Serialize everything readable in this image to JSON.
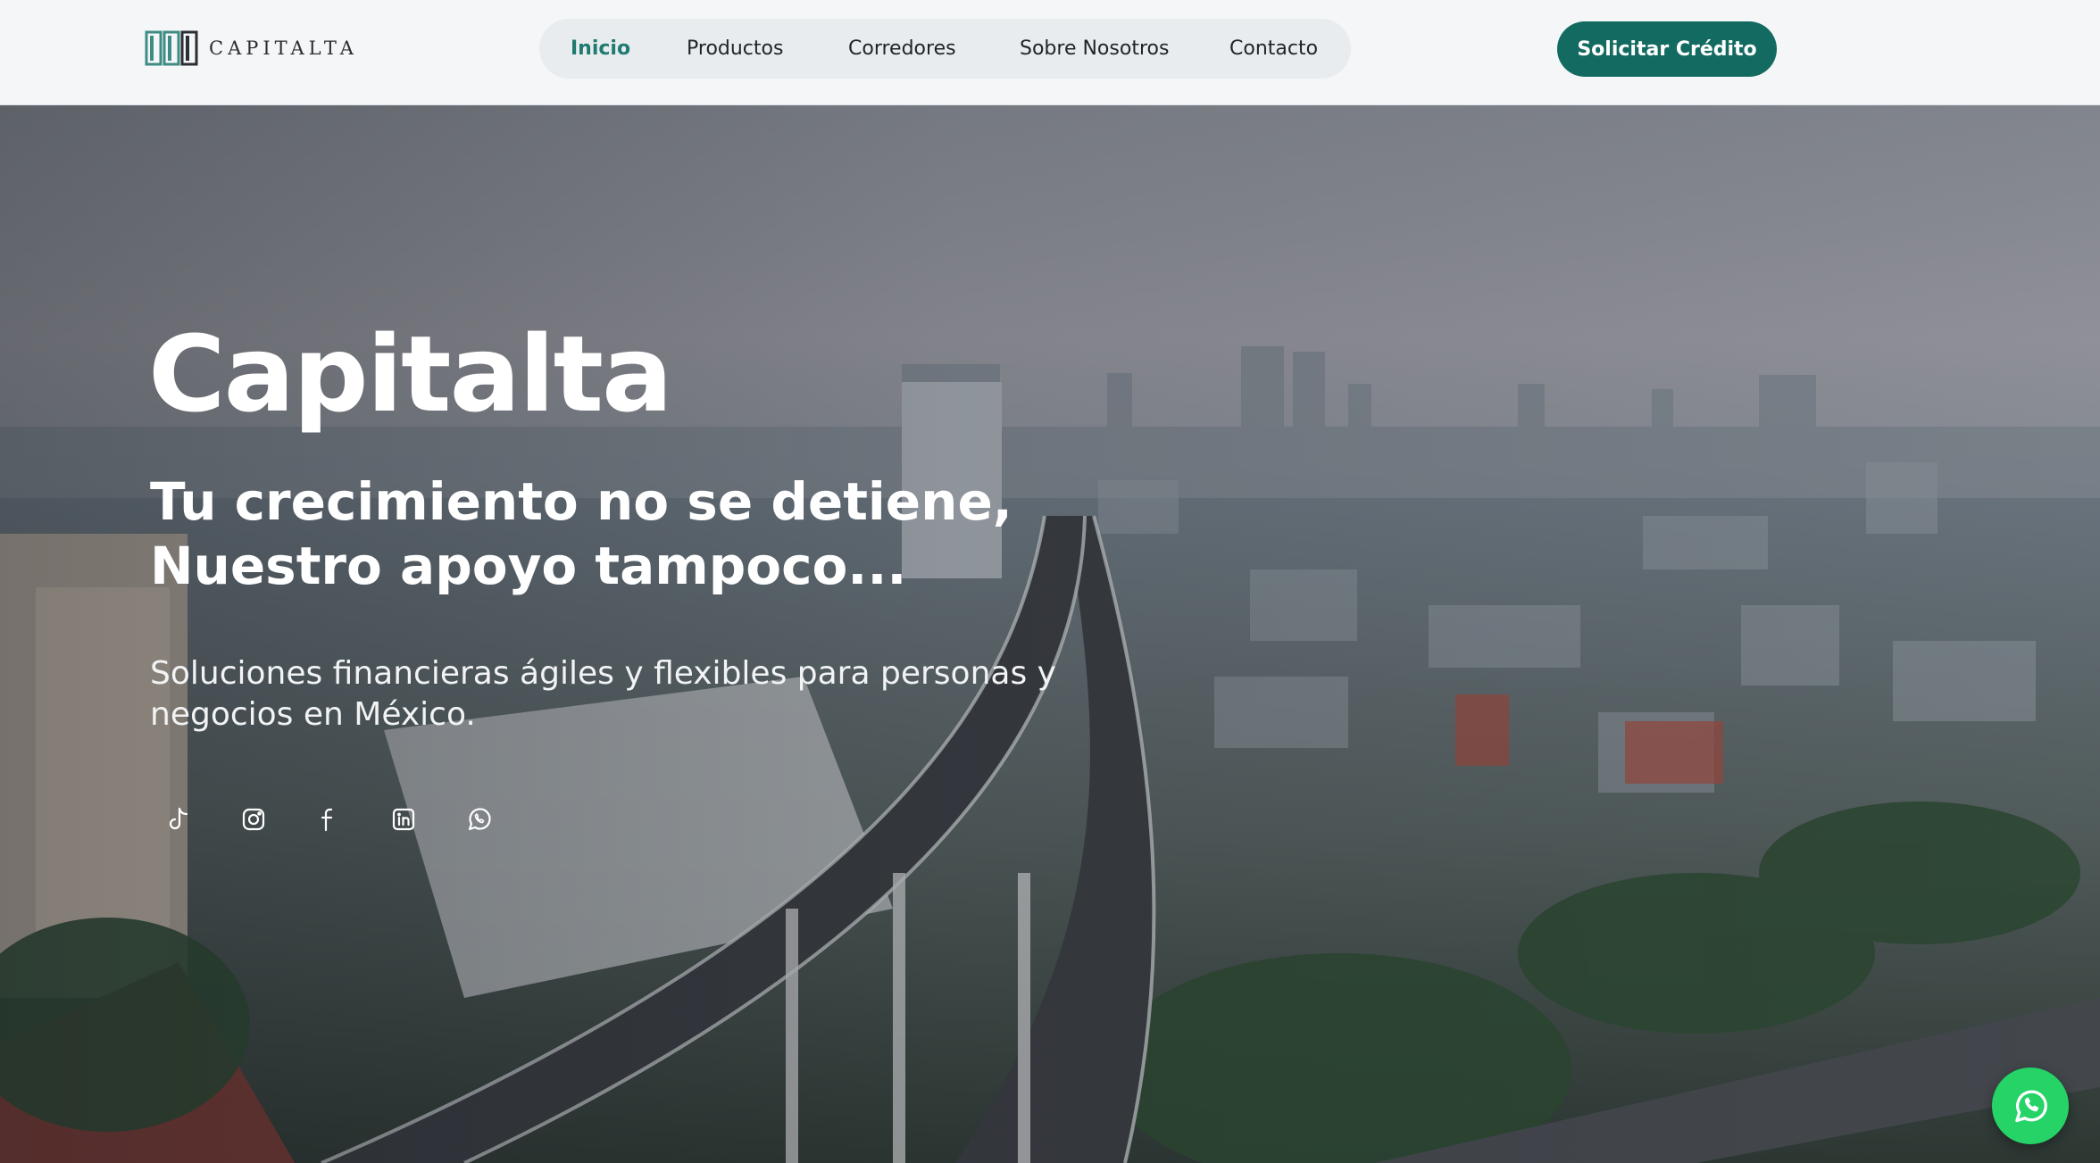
{
  "brand": {
    "name": "CAPITALTA",
    "accent_color": "#136a61",
    "logo_mark_color": "#3f8c84"
  },
  "nav": {
    "items": [
      {
        "label": "Inicio",
        "active": true
      },
      {
        "label": "Productos",
        "active": false
      },
      {
        "label": "Corredores",
        "active": false
      },
      {
        "label": "Sobre Nosotros",
        "active": false
      },
      {
        "label": "Contacto",
        "active": false
      }
    ],
    "cta_label": "Solicitar Crédito"
  },
  "hero": {
    "title": "Capitalta",
    "tagline_line1": "Tu crecimiento no se detiene,",
    "tagline_line2": "Nuestro apoyo tampoco...",
    "description": "Soluciones financieras ágiles y flexibles para personas y negocios en México.",
    "background": "aerial-city-highway-photo"
  },
  "socials": [
    {
      "icon": "tiktok-icon"
    },
    {
      "icon": "instagram-icon"
    },
    {
      "icon": "facebook-icon"
    },
    {
      "icon": "linkedin-icon"
    },
    {
      "icon": "whatsapp-icon"
    }
  ],
  "floating_button": {
    "icon": "whatsapp-icon",
    "color": "#25d366"
  }
}
